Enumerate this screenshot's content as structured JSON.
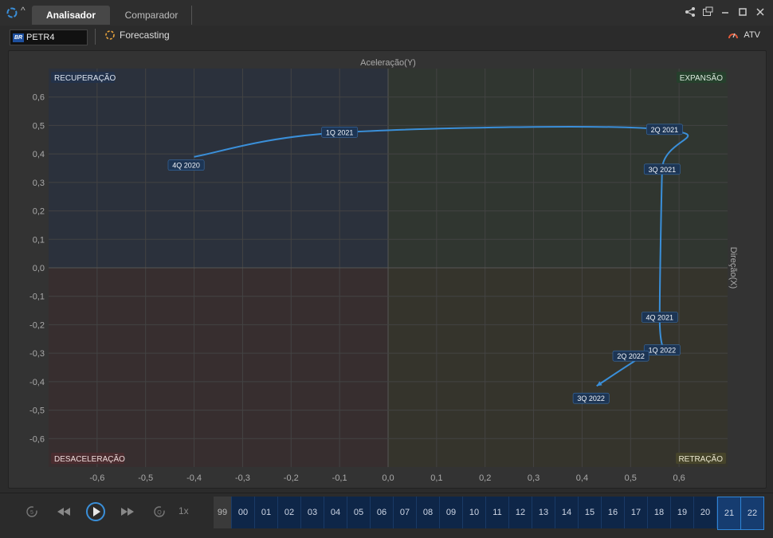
{
  "app": {
    "tabs": [
      {
        "label": "Analisador",
        "active": true
      },
      {
        "label": "Comparador",
        "active": false
      }
    ]
  },
  "toolbar": {
    "ticker": "PETR4",
    "ticker_flag": "BR",
    "forecasting_label": "Forecasting",
    "atv_label": "ATV"
  },
  "chart_data": {
    "type": "line",
    "title": "",
    "xlabel": "Aceleração(Y)",
    "ylabel": "Direção(X)",
    "xlim": [
      -0.7,
      0.7
    ],
    "ylim": [
      -0.7,
      0.7
    ],
    "xticks": [
      "-0,6",
      "-0,5",
      "-0,4",
      "-0,3",
      "-0,2",
      "-0,1",
      "0,0",
      "0,1",
      "0,2",
      "0,3",
      "0,4",
      "0,5",
      "0,6"
    ],
    "yticks": [
      "0,6",
      "0,5",
      "0,4",
      "0,3",
      "0,2",
      "0,1",
      "0,0",
      "-0,1",
      "-0,2",
      "-0,3",
      "-0,4",
      "-0,5",
      "-0,6"
    ],
    "quadrants": {
      "top_left": "RECUPERAÇÃO",
      "top_right": "EXPANSÃO",
      "bottom_left": "DESACELERAÇÃO",
      "bottom_right": "RETRAÇÃO"
    },
    "series": [
      {
        "color": "#3a8fd9",
        "points": [
          {
            "x": -0.4,
            "y": 0.39,
            "label": "4Q 2020"
          },
          {
            "x": -0.1,
            "y": 0.475,
            "label": "1Q 2021"
          },
          {
            "x": 0.57,
            "y": 0.485,
            "label": "2Q 2021"
          },
          {
            "x": 0.565,
            "y": 0.345,
            "label": "3Q 2021"
          },
          {
            "x": 0.56,
            "y": -0.175,
            "label": "4Q 2021"
          },
          {
            "x": 0.565,
            "y": -0.29,
            "label": "1Q 2022"
          },
          {
            "x": 0.535,
            "y": -0.3,
            "label": "2Q 2022"
          },
          {
            "x": 0.43,
            "y": -0.415,
            "label": "3Q 2022"
          }
        ]
      }
    ]
  },
  "playback": {
    "speed": "1x",
    "years": [
      "99",
      "00",
      "01",
      "02",
      "03",
      "04",
      "05",
      "06",
      "07",
      "08",
      "09",
      "10",
      "11",
      "12",
      "13",
      "14",
      "15",
      "16",
      "17",
      "18",
      "19",
      "20",
      "21",
      "22"
    ]
  }
}
